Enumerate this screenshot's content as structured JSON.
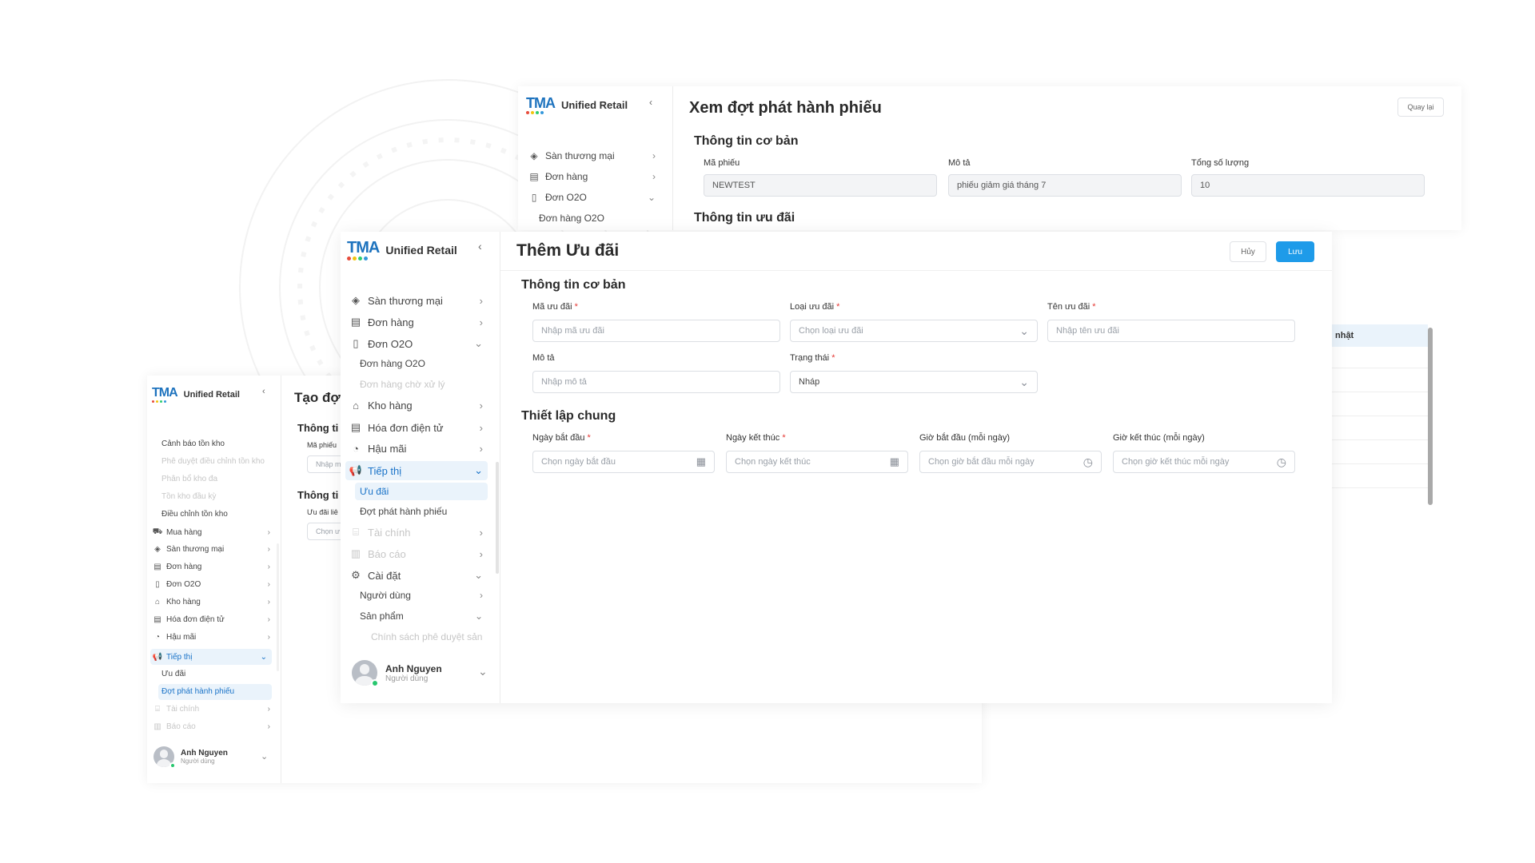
{
  "brand": {
    "logo_text": "TMA",
    "app_name": "Unified Retail"
  },
  "back_window": {
    "title": "Xem đợt phát hành phiếu",
    "back_button": "Quay lại",
    "nav": [
      "Sàn thương mại",
      "Đơn hàng",
      "Đơn O2O"
    ],
    "nav_sub": [
      "Đơn hàng O2O"
    ],
    "section_basic": "Thông tin cơ bản",
    "section_offer": "Thông tin ưu đãi",
    "fields": [
      {
        "label": "Mã phiếu",
        "value": "NEWTEST"
      },
      {
        "label": "Mô tả",
        "value": "phiếu giảm giá tháng 7"
      },
      {
        "label": "Tổng số lượng",
        "value": "10"
      }
    ],
    "table_header_fragment": "nhật"
  },
  "left_window": {
    "title": "Tạo đợt",
    "section_basic": "Thông ti",
    "label_code": "Mã phiếu",
    "placeholder_code": "Nhập m",
    "section_offer": "Thông ti",
    "label_offer": "Ưu đãi liê",
    "placeholder_offer": "Chọn ư",
    "nav_subs_faded": [
      "Phê duyệt điều chỉnh tồn kho",
      "Phân bổ kho đa",
      "Tồn kho đầu kỳ"
    ],
    "nav_sub_top": "Cảnh báo tồn kho",
    "nav_sub_bottom": "Điều chỉnh tồn kho",
    "nav": [
      "Mua hàng",
      "Sàn thương mại",
      "Đơn hàng",
      "Đơn O2O",
      "Kho hàng",
      "Hóa đơn điện tử",
      "Hậu mãi"
    ],
    "nav_active": "Tiếp thị",
    "nav_active_subs": [
      "Ưu đãi",
      "Đợt phát hành phiếu"
    ],
    "nav_faded": [
      "Tài chính",
      "Báo cáo"
    ],
    "user": {
      "name": "Anh Nguyen",
      "role": "Người dùng"
    }
  },
  "front_window": {
    "title": "Thêm Ưu đãi",
    "cancel_button": "Hủy",
    "save_button": "Lưu",
    "nav": {
      "san_thuong_mai": "Sàn thương mại",
      "don_hang": "Đơn hàng",
      "don_o2o": "Đơn O2O",
      "don_hang_o2o": "Đơn hàng O2O",
      "don_hang_cho_xu_ly": "Đơn hàng chờ xử lý",
      "kho_hang": "Kho hàng",
      "hoa_don": "Hóa đơn điện tử",
      "hau_mai": "Hậu mãi",
      "tiep_thi": "Tiếp thị",
      "uu_dai": "Ưu đãi",
      "dot_phat_hanh": "Đợt phát hành phiếu",
      "tai_chinh": "Tài chính",
      "bao_cao": "Báo cáo",
      "cai_dat": "Cài đặt",
      "nguoi_dung": "Người dùng",
      "san_pham": "Sản phẩm",
      "chinh_sach": "Chính sách phê duyệt sản"
    },
    "user": {
      "name": "Anh Nguyen",
      "role": "Người dùng"
    },
    "section_basic": "Thông tin cơ bản",
    "section_general": "Thiết lập chung",
    "fields": {
      "ma_uu_dai": {
        "label": "Mã ưu đãi",
        "placeholder": "Nhập mã ưu đãi"
      },
      "loai_uu_dai": {
        "label": "Loại ưu đãi",
        "placeholder": "Chọn loại ưu đãi"
      },
      "ten_uu_dai": {
        "label": "Tên ưu đãi",
        "placeholder": "Nhập tên ưu đãi"
      },
      "mo_ta": {
        "label": "Mô tả",
        "placeholder": "Nhập mô tả"
      },
      "trang_thai": {
        "label": "Trạng thái",
        "value": "Nháp"
      },
      "ngay_bat_dau": {
        "label": "Ngày bắt đầu",
        "placeholder": "Chọn ngày bắt đầu"
      },
      "ngay_ket_thuc": {
        "label": "Ngày kết thúc",
        "placeholder": "Chọn ngày kết thúc"
      },
      "gio_bat_dau": {
        "label": "Giờ bắt đầu (mỗi ngày)",
        "placeholder": "Chọn giờ bắt đầu mỗi ngày"
      },
      "gio_ket_thuc": {
        "label": "Giờ kết thúc (mỗi ngày)",
        "placeholder": "Chọn giờ kết thúc mỗi ngày"
      }
    },
    "required_mark": "*"
  },
  "colors": {
    "primary": "#1e9be9",
    "active_bg": "#eaf3fb",
    "active_text": "#1a73c8",
    "required": "#e53935"
  },
  "icons": [
    "tag-icon",
    "receipt-icon",
    "document-icon",
    "warehouse-icon",
    "invoice-icon",
    "support-icon",
    "megaphone-icon",
    "bank-icon",
    "report-icon",
    "gear-icon",
    "cart-icon",
    "calendar-icon",
    "clock-icon",
    "chevron-down-icon",
    "chevron-right-icon",
    "chevron-left-icon"
  ]
}
